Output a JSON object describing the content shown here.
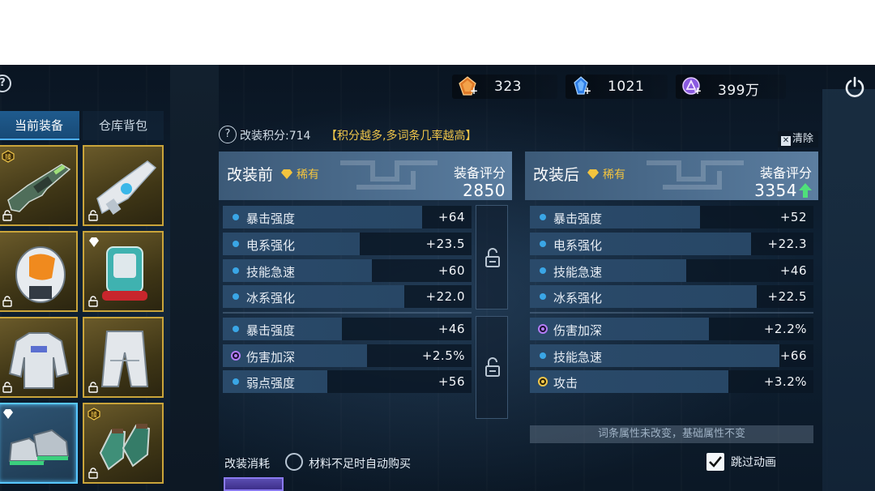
{
  "currencies": [
    {
      "icon": "orange-gem-icon",
      "amount": "323"
    },
    {
      "icon": "blue-crystal-icon",
      "amount": "1021"
    },
    {
      "icon": "purple-orb-icon",
      "amount": "399万"
    }
  ],
  "tabs": {
    "current": "当前装备",
    "warehouse": "仓库背包"
  },
  "slots": [
    {
      "name": "rifle",
      "badge": "臻"
    },
    {
      "name": "blaster"
    },
    {
      "name": "helmet"
    },
    {
      "name": "backpack",
      "badge": "gem"
    },
    {
      "name": "armor"
    },
    {
      "name": "pants"
    },
    {
      "name": "boots",
      "badge": "gem"
    },
    {
      "name": "gloves",
      "badge": "臻"
    }
  ],
  "score_line": {
    "label": "改装积分:714",
    "hint": "【积分越多,多词条几率越高】"
  },
  "clear_label": "清除",
  "before": {
    "title": "改装前",
    "rarity": "稀有",
    "score_label": "装备评分",
    "score": "2850",
    "group1": [
      {
        "name": "暴击强度",
        "value": "+64",
        "fill": 0.8,
        "dot": "blue"
      },
      {
        "name": "电系强化",
        "value": "+23.5",
        "fill": 0.55,
        "dot": "blue"
      },
      {
        "name": "技能急速",
        "value": "+60",
        "fill": 0.6,
        "dot": "blue"
      },
      {
        "name": "冰系强化",
        "value": "+22.0",
        "fill": 0.73,
        "dot": "blue"
      }
    ],
    "group2": [
      {
        "name": "暴击强度",
        "value": "+46",
        "fill": 0.48,
        "dot": "blue"
      },
      {
        "name": "伤害加深",
        "value": "+2.5%",
        "fill": 0.58,
        "dot": "purple"
      },
      {
        "name": "弱点强度",
        "value": "+56",
        "fill": 0.42,
        "dot": "blue"
      }
    ]
  },
  "after": {
    "title": "改装后",
    "rarity": "稀有",
    "score_label": "装备评分",
    "score": "3354",
    "group1": [
      {
        "name": "暴击强度",
        "value": "+52",
        "fill": 0.6,
        "dot": "blue"
      },
      {
        "name": "电系强化",
        "value": "+22.3",
        "fill": 0.78,
        "dot": "blue"
      },
      {
        "name": "技能急速",
        "value": "+46",
        "fill": 0.55,
        "dot": "blue"
      },
      {
        "name": "冰系强化",
        "value": "+22.5",
        "fill": 0.8,
        "dot": "blue"
      }
    ],
    "group2": [
      {
        "name": "伤害加深",
        "value": "+2.2%",
        "fill": 0.63,
        "dot": "purple"
      },
      {
        "name": "技能急速",
        "value": "+66",
        "fill": 0.88,
        "dot": "blue"
      },
      {
        "name": "攻击",
        "value": "+3.2%",
        "fill": 0.7,
        "dot": "gold"
      }
    ]
  },
  "note": "词条属性未改变，基础属性不变",
  "bottom": {
    "cost_label": "改装消耗",
    "auto_buy": "材料不足时自动购买",
    "skip_anim": "跳过动画",
    "skip_checked": true
  }
}
